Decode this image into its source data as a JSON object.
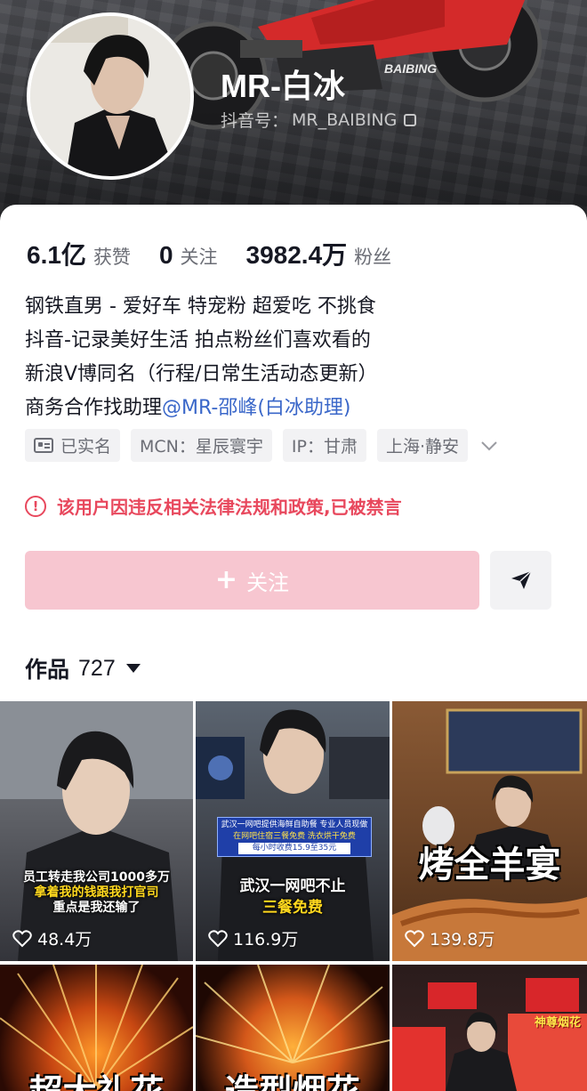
{
  "profile": {
    "name": "MR-白冰",
    "douyin_id_label": "抖音号：",
    "douyin_id": "MR_BAIBING",
    "banner_brand": "BAIBING"
  },
  "stats": [
    {
      "value": "6.1亿",
      "label": "获赞"
    },
    {
      "value": "0",
      "label": "关注"
    },
    {
      "value": "3982.4万",
      "label": "粉丝"
    }
  ],
  "bio": {
    "line1": "钢铁直男 - 爱好车 特宠粉 超爱吃 不挑食",
    "line2": "抖音-记录美好生活 拍点粉丝们喜欢看的",
    "line3": "新浪V博同名（行程/日常生活动态更新）",
    "line4_prefix": "商务合作找助理",
    "line4_mention": "@MR-邵峰(白冰助理)"
  },
  "tags": {
    "verified": "已实名",
    "mcn": "MCN：星辰寰宇",
    "ip": "IP：甘肃",
    "location": "上海·静安"
  },
  "ban_notice": "该用户因违反相关法律法规和政策,已被禁言",
  "actions": {
    "follow_label": "关注",
    "follow_color": "#f7c6d0"
  },
  "works": {
    "label": "作品",
    "count": "727"
  },
  "videos": [
    {
      "likes": "48.4万",
      "caption_lines": [
        "员工转走我公司1000多万",
        "拿着我的钱跟我打官司",
        "重点是我还输了"
      ]
    },
    {
      "likes": "116.9万",
      "overlay_lines": [
        "武汉一网吧提供海鲜自助餐 专业人员现做",
        "在网吧住宿三餐免费 洗衣烘干免费",
        "每小时收费15.9至35元"
      ],
      "caption_lines": [
        "武汉一网吧不止",
        "三餐免费"
      ]
    },
    {
      "likes": "139.8万",
      "caption_lines": [
        "烤全羊宴"
      ]
    },
    {
      "caption_lines": [
        "超大礼花"
      ]
    },
    {
      "caption_lines": [
        "造型烟花"
      ]
    },
    {
      "sign_text": "神尊烟花"
    }
  ],
  "colors": {
    "accent_red": "#e8485d",
    "mention_blue": "#3a67c9",
    "caption_yellow": "#ffd81e"
  }
}
